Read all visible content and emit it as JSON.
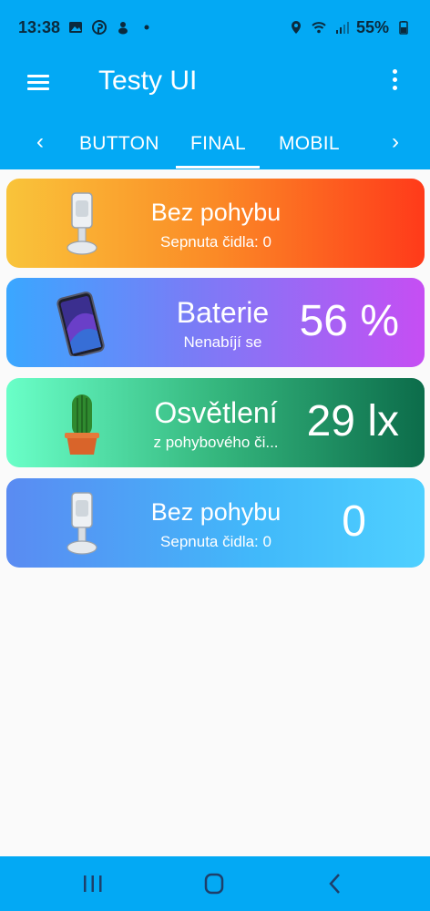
{
  "status_bar": {
    "time": "13:38",
    "battery_percent": "55%",
    "left_icons": [
      "gallery-icon",
      "pinterest-icon",
      "bear-icon",
      "dot-icon"
    ],
    "right_icons": [
      "location-icon",
      "wifi-icon",
      "signal-icon",
      "battery-icon"
    ]
  },
  "app_bar": {
    "title": "Testy UI",
    "menu_icon": "hamburger-menu-icon",
    "overflow_icon": "more-vertical-icon"
  },
  "tabs": {
    "items": [
      "BUTTON",
      "FINAL",
      "MOBIL"
    ],
    "selected": "FINAL",
    "prev_arrow": "‹",
    "next_arrow": "›"
  },
  "cards": [
    {
      "title": "Bez pohybu",
      "subtitle": "Sepnuta čidla: 0",
      "value": "",
      "icon": "motion-sensor-icon"
    },
    {
      "title": "Baterie",
      "subtitle": "Nenabíjí se",
      "value": "56 %",
      "icon": "smartphone-icon"
    },
    {
      "title": "Osvětlení",
      "subtitle": "z pohybového či...",
      "value": "29 lx",
      "icon": "cactus-icon"
    },
    {
      "title": "Bez pohybu",
      "subtitle": "Sepnuta čidla: 0",
      "value": "0",
      "icon": "motion-sensor-icon"
    }
  ],
  "nav_bar": {
    "buttons": [
      "recent-apps-icon",
      "home-icon",
      "back-icon"
    ]
  },
  "colors": {
    "primary": "#03a9f4",
    "background": "#fafafa"
  }
}
